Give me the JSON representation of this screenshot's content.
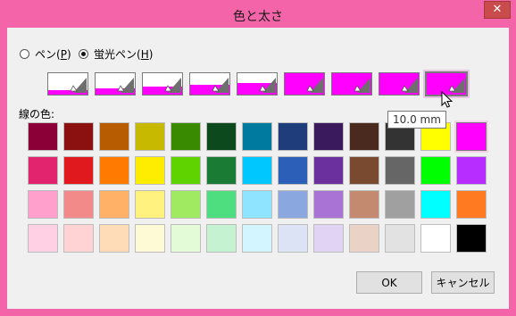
{
  "window": {
    "title": "色と太さ",
    "close_icon": "close-icon"
  },
  "pen_type": {
    "options": [
      {
        "label_pre": "ペン(",
        "mnemonic": "P",
        "label_post": ")",
        "checked": false
      },
      {
        "label_pre": "蛍光ペン(",
        "mnemonic": "H",
        "label_post": ")",
        "checked": true
      }
    ]
  },
  "thickness": {
    "fill_levels": [
      0.2,
      0.28,
      0.36,
      0.44,
      0.56,
      1.0,
      1.0,
      1.0,
      1.0
    ],
    "selected_index": 8,
    "fill_color": "#ff00ff",
    "tooltip": "10.0 mm"
  },
  "palette": {
    "label": "線の色:",
    "rows": [
      [
        "#8b0036",
        "#8b1111",
        "#b85c00",
        "#c7b800",
        "#3a8a00",
        "#0c4a1e",
        "#007b9f",
        "#1f3d7a",
        "#3a1a5c",
        "#4a2a1e",
        "#333333",
        "#ffff00",
        "#ff00ff"
      ],
      [
        "#e2246f",
        "#e0191f",
        "#ff7a00",
        "#ffed00",
        "#5ed300",
        "#1a7b34",
        "#00c8ff",
        "#2c5fb8",
        "#6b2f9e",
        "#7a4a30",
        "#666666",
        "#00ff00",
        "#b72cff"
      ],
      [
        "#ff9fcc",
        "#f28a8a",
        "#ffb267",
        "#fff27f",
        "#a0ea62",
        "#4ede80",
        "#8fe5ff",
        "#8aa7e0",
        "#a973d6",
        "#c48a70",
        "#a0a0a0",
        "#00ffff",
        "#ff7a21"
      ],
      [
        "#ffd0e3",
        "#ffd3d3",
        "#ffdcb8",
        "#fffad6",
        "#e4fbd8",
        "#c5f3d2",
        "#d2f5ff",
        "#dbe3f5",
        "#e0d3f3",
        "#ead2c7",
        "#e2e2e2",
        "#ffffff",
        "#000000"
      ]
    ],
    "selected": [
      0,
      12
    ]
  },
  "buttons": {
    "ok": "OK",
    "cancel": "キャンセル"
  }
}
